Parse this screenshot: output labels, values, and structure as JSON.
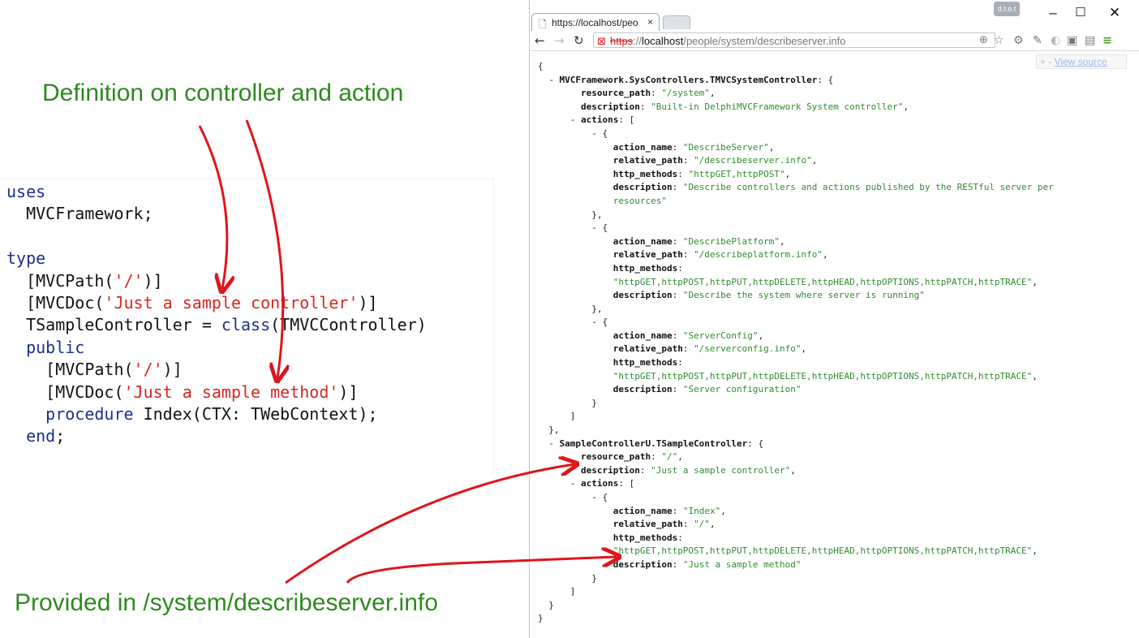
{
  "annotations": {
    "top": "Definition on controller and action",
    "bottom": "Provided in /system/describeserver.info"
  },
  "code": {
    "kw_uses": "uses",
    "framework_unit": "MVCFramework;",
    "kw_type": "type",
    "attr_path_open": "[MVCPath(",
    "str_root": "'/'",
    "attr_close": ")]",
    "attr_doc_open": "[MVCDoc(",
    "str_controller_doc": "'Just a sample controller'",
    "class_decl_pre": "TSampleController = ",
    "kw_class": "class",
    "class_decl_post": "(TMVCController)",
    "kw_public": "public",
    "str_method_doc": "'Just a sample method'",
    "kw_procedure": "procedure",
    "method_sig": " Index(CTX: TWebContext);",
    "kw_end": "end",
    "end_semicolon": ";"
  },
  "browser": {
    "tab_title": "https://localhost/peo",
    "tab_close": "×",
    "profile_badge": "d.t.e.t",
    "win_minimize": "–",
    "win_maximize": "☐",
    "win_close": "✕",
    "url_scheme": "https",
    "url_sep": "://",
    "url_host": "localhost",
    "url_path": "/people/system/describeserver.info",
    "view_source_prefix": "+ - ",
    "view_source_link": "View source"
  },
  "icons": {
    "tab_page": "page-icon",
    "back": "back-arrow-icon",
    "forward": "forward-arrow-icon",
    "reload": "reload-icon",
    "insecure": "insecure-lock-icon",
    "zoom": "zoom-icon",
    "bookmark": "star-icon",
    "menu": "hamburger-menu-icon"
  },
  "colors": {
    "annotation_green": "#2d8a1e",
    "arrow_red": "#e0141b",
    "keyword_blue": "#1c2f8f",
    "string_red": "#d6261f",
    "json_string_green": "#2f8c2f"
  },
  "json": {
    "brace_open": "{",
    "brace_close": "}",
    "bracket_open": "[",
    "bracket_close": "]",
    "toggle": "- ",
    "obj_close_comma": "},",
    "obj_close": "}",
    "sys_ctrl_key": "MVCFramework.SysControllers.TMVCSystemController",
    "sample_ctrl_key": "SampleControllerU.TSampleController",
    "k_resource_path": "resource_path",
    "k_description": "description",
    "k_actions": "actions",
    "k_action_name": "action_name",
    "k_relative_path": "relative_path",
    "k_http_methods": "http_methods",
    "sys_resource_path": "\"/system\"",
    "sys_description": "\"Built-in DelphiMVCFramework System controller\"",
    "a1_name": "\"DescribeServer\"",
    "a1_path": "\"/describeserver.info\"",
    "a1_methods": "\"httpGET,httpPOST\"",
    "a1_desc_line1": "\"Describe controllers and actions published by the RESTful server per",
    "a1_desc_line2": "resources\"",
    "a2_name": "\"DescribePlatform\"",
    "a2_path": "\"/describeplatform.info\"",
    "all_methods": "\"httpGET,httpPOST,httpPUT,httpDELETE,httpHEAD,httpOPTIONS,httpPATCH,httpTRACE\"",
    "a2_desc": "\"Describe the system where server is running\"",
    "a3_name": "\"ServerConfig\"",
    "a3_path": "\"/serverconfig.info\"",
    "a3_desc": "\"Server configuration\"",
    "sample_resource_path": "\"/\"",
    "sample_description": "\"Just a sample controller\"",
    "s1_name": "\"Index\"",
    "s1_path": "\"/\"",
    "s1_desc": "\"Just a sample method\""
  }
}
